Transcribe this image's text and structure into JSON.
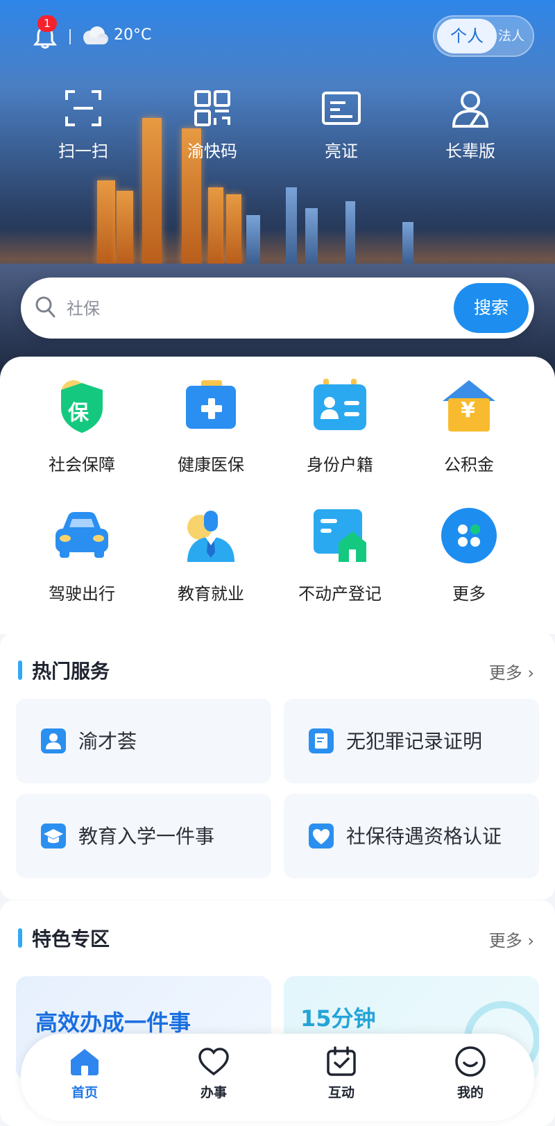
{
  "topbar": {
    "notification_count": "1",
    "temperature": "20°C",
    "weather_icon": "cloud-icon",
    "mode_active": "个人",
    "mode_inactive": "法人"
  },
  "quick_actions": [
    {
      "label": "扫一扫",
      "icon": "scan-icon"
    },
    {
      "label": "渝快码",
      "icon": "qr-code-icon"
    },
    {
      "label": "亮证",
      "icon": "id-card-icon"
    },
    {
      "label": "长辈版",
      "icon": "elder-mode-icon"
    }
  ],
  "search": {
    "placeholder": "社保",
    "button_label": "搜索"
  },
  "categories": [
    {
      "label": "社会保障",
      "icon": "shield-icon",
      "icon_text": "保"
    },
    {
      "label": "健康医保",
      "icon": "medical-kit-icon"
    },
    {
      "label": "身份户籍",
      "icon": "id-profile-icon"
    },
    {
      "label": "公积金",
      "icon": "house-yuan-icon",
      "icon_text": "¥"
    },
    {
      "label": "驾驶出行",
      "icon": "car-icon"
    },
    {
      "label": "教育就业",
      "icon": "person-tie-icon"
    },
    {
      "label": "不动产登记",
      "icon": "property-icon"
    },
    {
      "label": "更多",
      "icon": "more-apps-icon"
    }
  ],
  "hot_services": {
    "title": "热门服务",
    "more": "更多",
    "items": [
      {
        "label": "渝才荟",
        "icon": "talent-icon"
      },
      {
        "label": "无犯罪记录证明",
        "icon": "certificate-icon"
      },
      {
        "label": "教育入学一件事",
        "icon": "graduation-cap-icon"
      },
      {
        "label": "社保待遇资格认证",
        "icon": "heart-shield-icon"
      }
    ]
  },
  "featured": {
    "title": "特色专区",
    "more": "更多",
    "cards": [
      {
        "label": "高效办成一件事"
      },
      {
        "label": "15分钟"
      }
    ]
  },
  "tabbar": [
    {
      "label": "首页",
      "icon": "home-icon",
      "active": true
    },
    {
      "label": "办事",
      "icon": "heart-icon",
      "active": false
    },
    {
      "label": "互动",
      "icon": "calendar-check-icon",
      "active": false
    },
    {
      "label": "我的",
      "icon": "smile-face-icon",
      "active": false
    }
  ],
  "colors": {
    "primary": "#1d8ef0",
    "accent_bar": "#2fa9f5",
    "badge": "#f5222d",
    "tab_active": "#1f76e8"
  }
}
